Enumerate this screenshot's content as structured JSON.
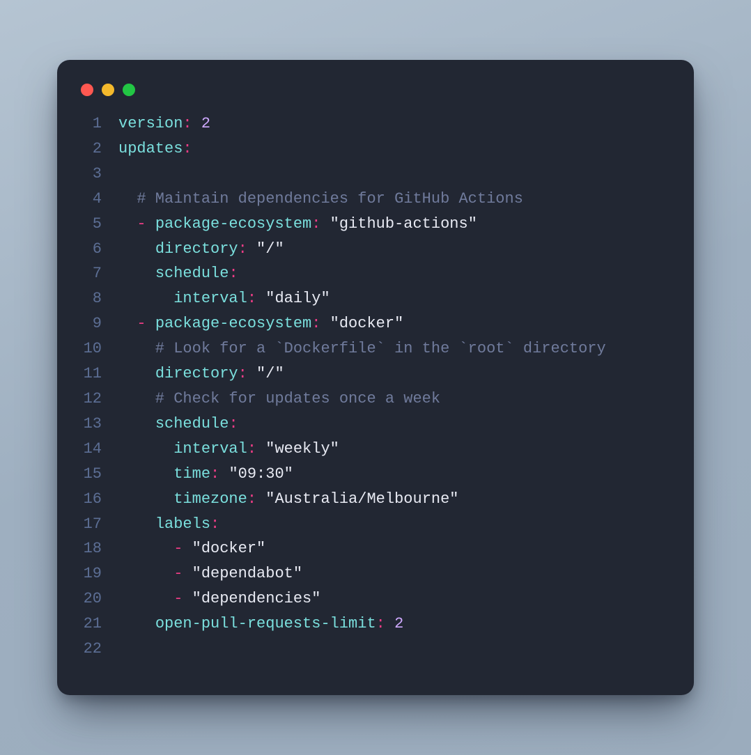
{
  "traffic": {
    "red": "close",
    "yellow": "minimize",
    "green": "zoom"
  },
  "code": {
    "lines": [
      {
        "n": "1",
        "segs": [
          [
            "k",
            "version"
          ],
          [
            "p",
            ":"
          ],
          [
            "s",
            " "
          ],
          [
            "n",
            "2"
          ]
        ]
      },
      {
        "n": "2",
        "segs": [
          [
            "k",
            "updates"
          ],
          [
            "p",
            ":"
          ]
        ]
      },
      {
        "n": "3",
        "segs": []
      },
      {
        "n": "4",
        "segs": [
          [
            "c",
            "  # Maintain dependencies for GitHub Actions"
          ]
        ]
      },
      {
        "n": "5",
        "segs": [
          [
            "s",
            "  "
          ],
          [
            "p",
            "-"
          ],
          [
            "s",
            " "
          ],
          [
            "k",
            "package-ecosystem"
          ],
          [
            "p",
            ":"
          ],
          [
            "s",
            " "
          ],
          [
            "q",
            "\""
          ],
          [
            "s",
            "github-actions"
          ],
          [
            "q",
            "\""
          ]
        ]
      },
      {
        "n": "6",
        "segs": [
          [
            "s",
            "    "
          ],
          [
            "k",
            "directory"
          ],
          [
            "p",
            ":"
          ],
          [
            "s",
            " "
          ],
          [
            "q",
            "\""
          ],
          [
            "s",
            "/"
          ],
          [
            "q",
            "\""
          ]
        ]
      },
      {
        "n": "7",
        "segs": [
          [
            "s",
            "    "
          ],
          [
            "k",
            "schedule"
          ],
          [
            "p",
            ":"
          ]
        ]
      },
      {
        "n": "8",
        "segs": [
          [
            "s",
            "      "
          ],
          [
            "k",
            "interval"
          ],
          [
            "p",
            ":"
          ],
          [
            "s",
            " "
          ],
          [
            "q",
            "\""
          ],
          [
            "s",
            "daily"
          ],
          [
            "q",
            "\""
          ]
        ]
      },
      {
        "n": "9",
        "segs": [
          [
            "s",
            "  "
          ],
          [
            "p",
            "-"
          ],
          [
            "s",
            " "
          ],
          [
            "k",
            "package-ecosystem"
          ],
          [
            "p",
            ":"
          ],
          [
            "s",
            " "
          ],
          [
            "q",
            "\""
          ],
          [
            "s",
            "docker"
          ],
          [
            "q",
            "\""
          ]
        ]
      },
      {
        "n": "10",
        "segs": [
          [
            "c",
            "    # Look for a `Dockerfile` in the `root` directory"
          ]
        ]
      },
      {
        "n": "11",
        "segs": [
          [
            "s",
            "    "
          ],
          [
            "k",
            "directory"
          ],
          [
            "p",
            ":"
          ],
          [
            "s",
            " "
          ],
          [
            "q",
            "\""
          ],
          [
            "s",
            "/"
          ],
          [
            "q",
            "\""
          ]
        ]
      },
      {
        "n": "12",
        "segs": [
          [
            "c",
            "    # Check for updates once a week"
          ]
        ]
      },
      {
        "n": "13",
        "segs": [
          [
            "s",
            "    "
          ],
          [
            "k",
            "schedule"
          ],
          [
            "p",
            ":"
          ]
        ]
      },
      {
        "n": "14",
        "segs": [
          [
            "s",
            "      "
          ],
          [
            "k",
            "interval"
          ],
          [
            "p",
            ":"
          ],
          [
            "s",
            " "
          ],
          [
            "q",
            "\""
          ],
          [
            "s",
            "weekly"
          ],
          [
            "q",
            "\""
          ]
        ]
      },
      {
        "n": "15",
        "segs": [
          [
            "s",
            "      "
          ],
          [
            "k",
            "time"
          ],
          [
            "p",
            ":"
          ],
          [
            "s",
            " "
          ],
          [
            "q",
            "\""
          ],
          [
            "s",
            "09:30"
          ],
          [
            "q",
            "\""
          ]
        ]
      },
      {
        "n": "16",
        "segs": [
          [
            "s",
            "      "
          ],
          [
            "k",
            "timezone"
          ],
          [
            "p",
            ":"
          ],
          [
            "s",
            " "
          ],
          [
            "q",
            "\""
          ],
          [
            "s",
            "Australia/Melbourne"
          ],
          [
            "q",
            "\""
          ]
        ]
      },
      {
        "n": "17",
        "segs": [
          [
            "s",
            "    "
          ],
          [
            "k",
            "labels"
          ],
          [
            "p",
            ":"
          ]
        ]
      },
      {
        "n": "18",
        "segs": [
          [
            "s",
            "      "
          ],
          [
            "p",
            "-"
          ],
          [
            "s",
            " "
          ],
          [
            "q",
            "\""
          ],
          [
            "s",
            "docker"
          ],
          [
            "q",
            "\""
          ]
        ]
      },
      {
        "n": "19",
        "segs": [
          [
            "s",
            "      "
          ],
          [
            "p",
            "-"
          ],
          [
            "s",
            " "
          ],
          [
            "q",
            "\""
          ],
          [
            "s",
            "dependabot"
          ],
          [
            "q",
            "\""
          ]
        ]
      },
      {
        "n": "20",
        "segs": [
          [
            "s",
            "      "
          ],
          [
            "p",
            "-"
          ],
          [
            "s",
            " "
          ],
          [
            "q",
            "\""
          ],
          [
            "s",
            "dependencies"
          ],
          [
            "q",
            "\""
          ]
        ]
      },
      {
        "n": "21",
        "segs": [
          [
            "s",
            "    "
          ],
          [
            "k",
            "open-pull-requests-limit"
          ],
          [
            "p",
            ":"
          ],
          [
            "s",
            " "
          ],
          [
            "n",
            "2"
          ]
        ]
      },
      {
        "n": "22",
        "segs": []
      }
    ]
  }
}
